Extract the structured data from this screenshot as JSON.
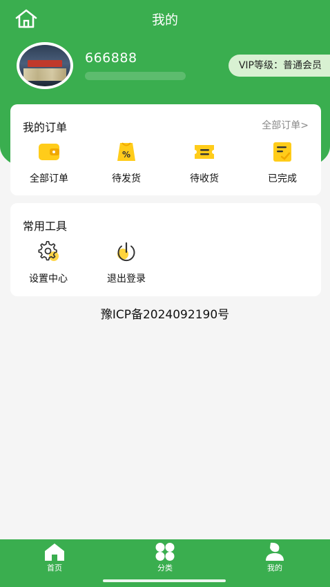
{
  "header": {
    "title": "我的",
    "home_icon": "home-outline-icon"
  },
  "user": {
    "name": "666888",
    "vip_badge": "VIP等级：普通会员"
  },
  "orders_card": {
    "title": "我的订单",
    "all_link": "全部订单>",
    "items": [
      {
        "label": "全部订单",
        "icon": "wallet-icon"
      },
      {
        "label": "待发货",
        "icon": "discount-bag-icon"
      },
      {
        "label": "待收货",
        "icon": "ticket-icon"
      },
      {
        "label": "已完成",
        "icon": "check-note-icon"
      }
    ]
  },
  "tools_card": {
    "title": "常用工具",
    "items": [
      {
        "label": "设置中心",
        "icon": "gear-icon"
      },
      {
        "label": "退出登录",
        "icon": "power-icon"
      }
    ]
  },
  "footer": {
    "icp": "豫ICP备2024092190号"
  },
  "tabbar": {
    "items": [
      {
        "label": "首页",
        "icon": "home-icon"
      },
      {
        "label": "分类",
        "icon": "grid-icon"
      },
      {
        "label": "我的",
        "icon": "user-icon"
      }
    ]
  },
  "colors": {
    "brand_green": "#3aae4f",
    "icon_yellow": "#ffcc1a",
    "vip_bg": "#d8f1d2"
  }
}
